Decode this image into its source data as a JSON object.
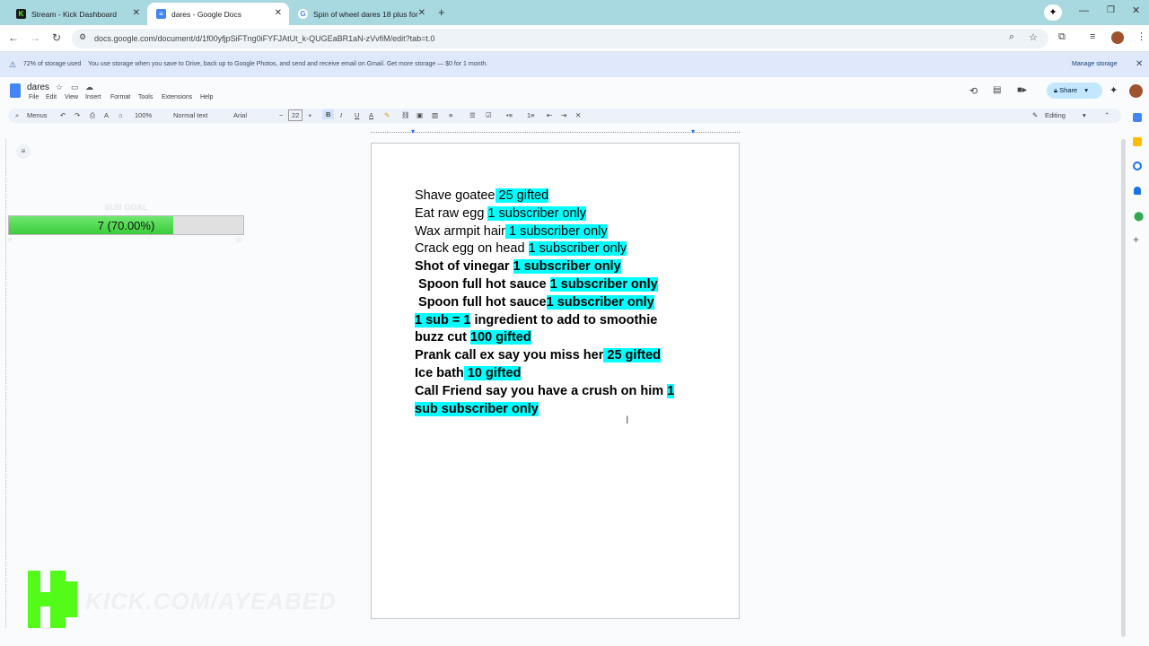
{
  "browser": {
    "tabs": [
      {
        "title": "Stream - Kick Dashboard",
        "active": false
      },
      {
        "title": "dares - Google Docs",
        "active": true
      },
      {
        "title": "Spin of wheel dares 18 plus for",
        "active": false
      }
    ],
    "url": "docs.google.com/document/d/1f00yfjpSiFTng0iFYFJAtUt_k-QUGEaBR1aN-zVvfiM/edit?tab=t.0"
  },
  "banner": {
    "storage_used": "72% of storage used",
    "message": "You use storage when you save to Drive, back up to Google Photos, and send and receive email on Gmail. Get more storage — $0 for 1 month.",
    "manage_label": "Manage storage"
  },
  "docs": {
    "title": "dares",
    "menus": [
      "File",
      "Edit",
      "View",
      "Insert",
      "Format",
      "Tools",
      "Extensions",
      "Help"
    ],
    "share_label": "Share",
    "toolbar": {
      "menus_label": "Menus",
      "zoom": "100%",
      "style": "Normal text",
      "font": "Arial",
      "font_size": "22",
      "mode": "Editing"
    }
  },
  "document": {
    "lines": [
      {
        "text": "Shave goatee",
        "hl": " 25 gifted",
        "bold": false
      },
      {
        "text": "Eat raw egg ",
        "hl": "1 subscriber only",
        "bold": false
      },
      {
        "text": "Wax armpit hair",
        "hl": " 1 subscriber only",
        "bold": false
      },
      {
        "text": "Crack egg on head ",
        "hl": "1 subscriber only",
        "bold": false
      },
      {
        "text": "Shot of vinegar ",
        "hl": "1 subscriber only",
        "bold": true
      },
      {
        "text": " Spoon full hot sauce ",
        "hl": "1 subscriber only",
        "bold": true
      },
      {
        "text": " Spoon full hot sauce",
        "hl": "1 subscriber only",
        "bold": true
      },
      {
        "pre_hl": "1 sub = 1",
        "text": " ingredient to add to smoothie",
        "bold": true
      },
      {
        "text": "buzz cut ",
        "hl": "100 gifted",
        "bold": true
      },
      {
        "text": "Prank call ex say you miss her",
        "hl": " 25 gifted",
        "bold": true
      },
      {
        "text": "Ice bath",
        "hl": " 10 gifted",
        "bold": true
      },
      {
        "text": "Call Friend say you have a crush on him ",
        "hl": "1",
        "bold": true
      },
      {
        "text": "",
        "hl": "sub subscriber only",
        "bold": true
      }
    ]
  },
  "overlay": {
    "subgoal_title": "SUB GOAL",
    "subgoal_text": "7 (70.00%)",
    "subgoal_fraction": 0.7,
    "min": "0",
    "max": "10",
    "watermark": "KICK.COM/AYEABED"
  },
  "colors": {
    "highlight": "#00ffff",
    "tabstrip": "#a8d8e0",
    "kick_green": "#53fc18"
  }
}
